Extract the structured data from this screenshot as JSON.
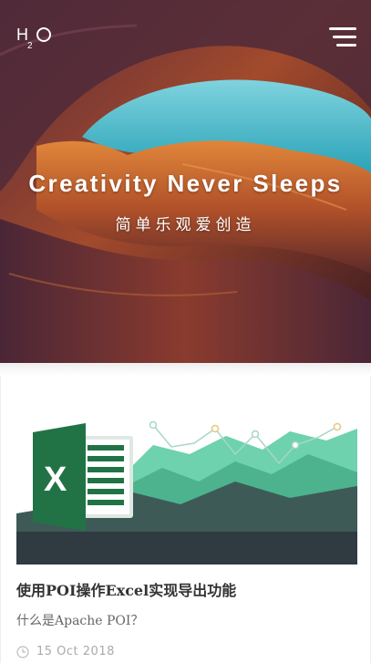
{
  "header": {
    "logo_icon": "h2o-logo",
    "menu_icon": "hamburger-menu-icon"
  },
  "hero": {
    "title": "Creativity Never Sleeps",
    "subtitle": "简单乐观爱创造"
  },
  "post": {
    "thumbnail": "excel-chart-thumbnail",
    "title": "使用POI操作Excel实现导出功能",
    "excerpt": "什么是Apache POI？",
    "date_icon": "clock-icon",
    "date": "15 Oct 2018"
  },
  "colors": {
    "excel_green": "#217346",
    "thumb_dark": "#2f3b40",
    "thumb_teal": "#52c49a"
  }
}
